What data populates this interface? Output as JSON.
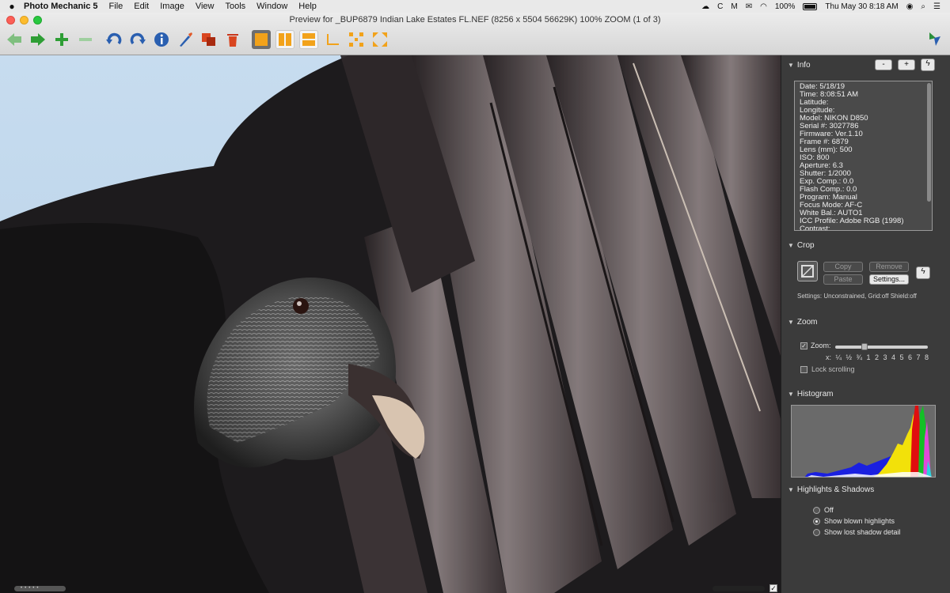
{
  "menubar": {
    "apple": "",
    "app_name": "Photo Mechanic 5",
    "menus": [
      "File",
      "Edit",
      "Image",
      "View",
      "Tools",
      "Window",
      "Help"
    ],
    "battery": "100%",
    "datetime": "Thu May 30  8:18 AM"
  },
  "window": {
    "title": "Preview for _BUP6879  Indian Lake Estates FL.NEF (8256 x 5504 56629K) 100% ZOOM (1 of 3)"
  },
  "toolbar": {
    "icons": [
      "back-arrow-icon",
      "forward-arrow-icon",
      "add-icon",
      "remove-icon",
      "rotate-left-icon",
      "rotate-right-icon",
      "info-icon",
      "edit-brush-icon",
      "copy-icon",
      "trash-icon",
      "single-view-icon",
      "side-by-side-icon",
      "stacked-view-icon",
      "crop-corner-icon",
      "grid-expand-icon"
    ]
  },
  "panel": {
    "info": {
      "title": "Info",
      "minus": "-",
      "plus": "+",
      "lines": [
        "Date: 5/18/19",
        "Time: 8:08:51 AM",
        "Latitude:",
        "Longitude:",
        "Model: NIKON D850",
        "Serial #: 3027786",
        "Firmware: Ver.1.10",
        "Frame #: 6879",
        "Lens (mm): 500",
        "ISO: 800",
        "Aperture: 6.3",
        "Shutter: 1/2000",
        "Exp. Comp.: 0.0",
        "Flash Comp.: 0.0",
        "Program: Manual",
        "Focus Mode: AF-C",
        "White Bal.: AUTO1",
        "ICC Profile: Adobe RGB (1998)",
        "Contrast:"
      ]
    },
    "crop": {
      "title": "Crop",
      "copy": "Copy",
      "remove": "Remove",
      "paste": "Paste",
      "settings_button": "Settings...",
      "settings_text": "Settings:    Unconstrained, Grid:off Shield:off"
    },
    "zoom": {
      "title": "Zoom",
      "label": "Zoom:",
      "checked": "✓",
      "scale": "x:  ¼ ½ ¾ 1  2  3  4  5  6  7  8",
      "level": 0.3,
      "lock": "Lock scrolling"
    },
    "histogram": {
      "title": "Histogram"
    },
    "highlights": {
      "title": "Highlights & Shadows",
      "options": [
        "Off",
        "Show blown highlights",
        "Show lost shadow detail"
      ],
      "selected": 1
    }
  },
  "colors": {
    "toolbar_green": "#3aa33a",
    "toolbar_blue": "#2a5fb0",
    "toolbar_orange": "#f2a21a",
    "panel_bg": "#3b3b3b"
  }
}
